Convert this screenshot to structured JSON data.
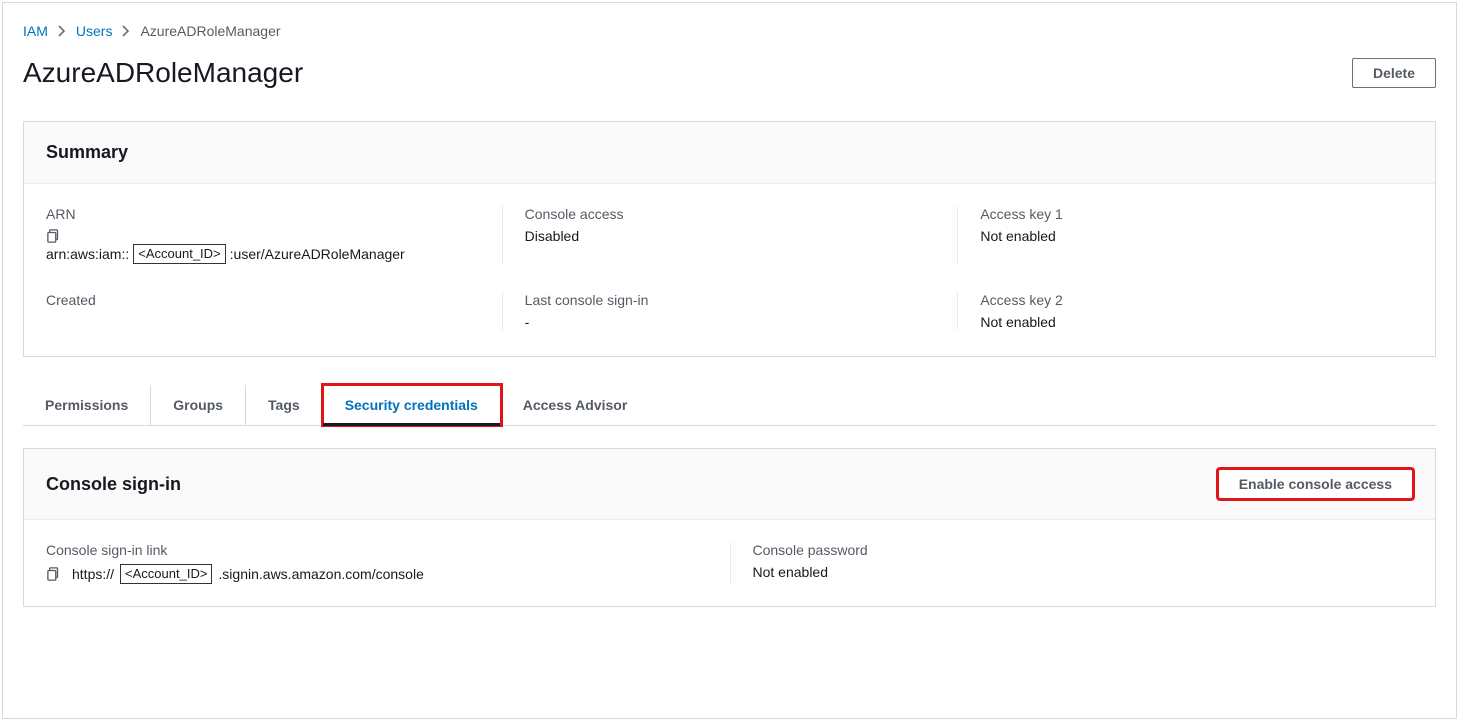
{
  "breadcrumb": {
    "root": "IAM",
    "second": "Users",
    "current": "AzureADRoleManager"
  },
  "header": {
    "title": "AzureADRoleManager",
    "delete": "Delete"
  },
  "summary": {
    "title": "Summary",
    "arn_label": "ARN",
    "arn_prefix": "arn:aws:iam::",
    "arn_placeholder": "<Account_ID>",
    "arn_suffix": ":user/AzureADRoleManager",
    "console_access_label": "Console access",
    "console_access_value": "Disabled",
    "access_key1_label": "Access key 1",
    "access_key1_value": "Not enabled",
    "created_label": "Created",
    "created_value": "",
    "last_signin_label": "Last console sign-in",
    "last_signin_value": "-",
    "access_key2_label": "Access key 2",
    "access_key2_value": "Not enabled"
  },
  "tabs": {
    "permissions": "Permissions",
    "groups": "Groups",
    "tags": "Tags",
    "security": "Security credentials",
    "advisor": "Access Advisor"
  },
  "console_signin": {
    "title": "Console sign-in",
    "enable_button": "Enable console access",
    "link_label": "Console sign-in link",
    "link_prefix": "https://",
    "link_placeholder": "<Account_ID>",
    "link_suffix": ".signin.aws.amazon.com/console",
    "password_label": "Console password",
    "password_value": "Not enabled"
  }
}
